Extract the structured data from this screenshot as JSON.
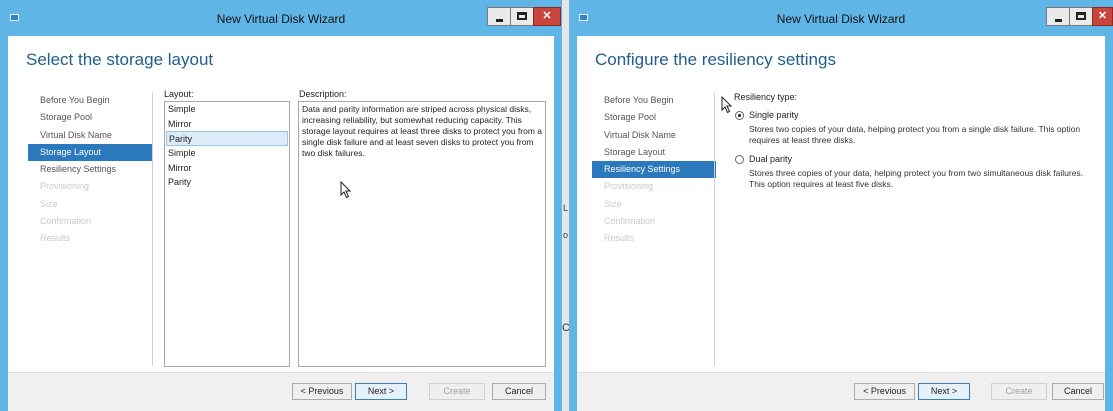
{
  "left_window": {
    "title": "New Virtual Disk Wizard",
    "heading": "Select the storage layout",
    "steps": [
      "Before You Begin",
      "Storage Pool",
      "Virtual Disk Name",
      "Storage Layout",
      "Resiliency Settings",
      "Provisioning",
      "Size",
      "Confirmation",
      "Results"
    ],
    "selected_step": "Storage Layout",
    "layout_label": "Layout:",
    "layout_items": [
      "Simple",
      "Mirror",
      "Parity",
      "Simple",
      "Mirror",
      "Parity"
    ],
    "selected_layout": "Parity",
    "description_label": "Description:",
    "description": "Data and parity information are striped across physical disks, increasing reliability, but somewhat reducing capacity. This storage layout requires at least three disks to protect you from a single disk failure and at least seven disks to protect you from two disk failures.",
    "buttons": {
      "previous": "< Previous",
      "next": "Next >",
      "create": "Create",
      "cancel": "Cancel"
    }
  },
  "right_window": {
    "title": "New Virtual Disk Wizard",
    "heading": "Configure the resiliency settings",
    "steps": [
      "Before You Begin",
      "Storage Pool",
      "Virtual Disk Name",
      "Storage Layout",
      "Resiliency Settings",
      "Provisioning",
      "Size",
      "Confirmation",
      "Results"
    ],
    "selected_step": "Resiliency Settings",
    "resiliency_label": "Resiliency type:",
    "options": [
      {
        "label": "Single parity",
        "selected": true,
        "description": "Stores two copies of your data, helping protect you from a single disk failure. This option requires at least three disks."
      },
      {
        "label": "Dual parity",
        "selected": false,
        "description": "Stores three copies of your data, helping protect you from two simultaneous disk failures. This option requires at least five disks."
      }
    ],
    "buttons": {
      "previous": "< Previous",
      "next": "Next >",
      "create": "Create",
      "cancel": "Cancel"
    }
  },
  "between_windows": {
    "marks": [
      "L",
      "o",
      "C"
    ]
  },
  "colors": {
    "frame": "#5fb6e6",
    "accent": "#2c78bd",
    "heading": "#1f5f8c",
    "close": "#c9453c"
  }
}
